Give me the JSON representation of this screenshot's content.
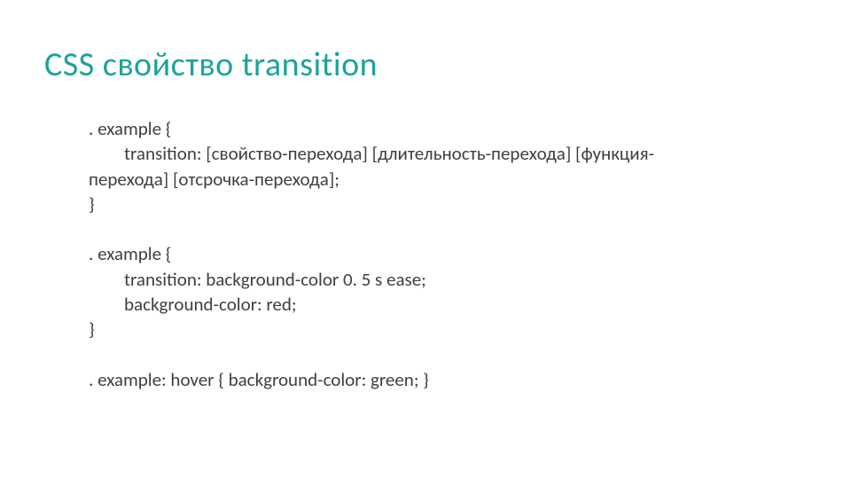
{
  "title": "CSS свойство transition",
  "block1": {
    "sel_prefix": ". ",
    "sel": "example",
    "open": " {",
    "line1_prop": "transition: ",
    "line1_val": "[свойство-перехода] [длительность-перехода] [функция-",
    "line2_val": "перехода] [отсрочка-перехода]; ",
    "close": "}"
  },
  "block2": {
    "sel_prefix": ". ",
    "sel": "example",
    "open": " {",
    "line1_prop": "transition: ",
    "line1_val": "background-color 0. 5 s ease; ",
    "line2_prop": "background-color: ",
    "line2_val": "red; ",
    "close": "}"
  },
  "block3": {
    "sel_prefix": ". ",
    "sel": "example: hover",
    "open": " { ",
    "prop": "background-color: ",
    "val": "green;",
    "close": " }"
  }
}
